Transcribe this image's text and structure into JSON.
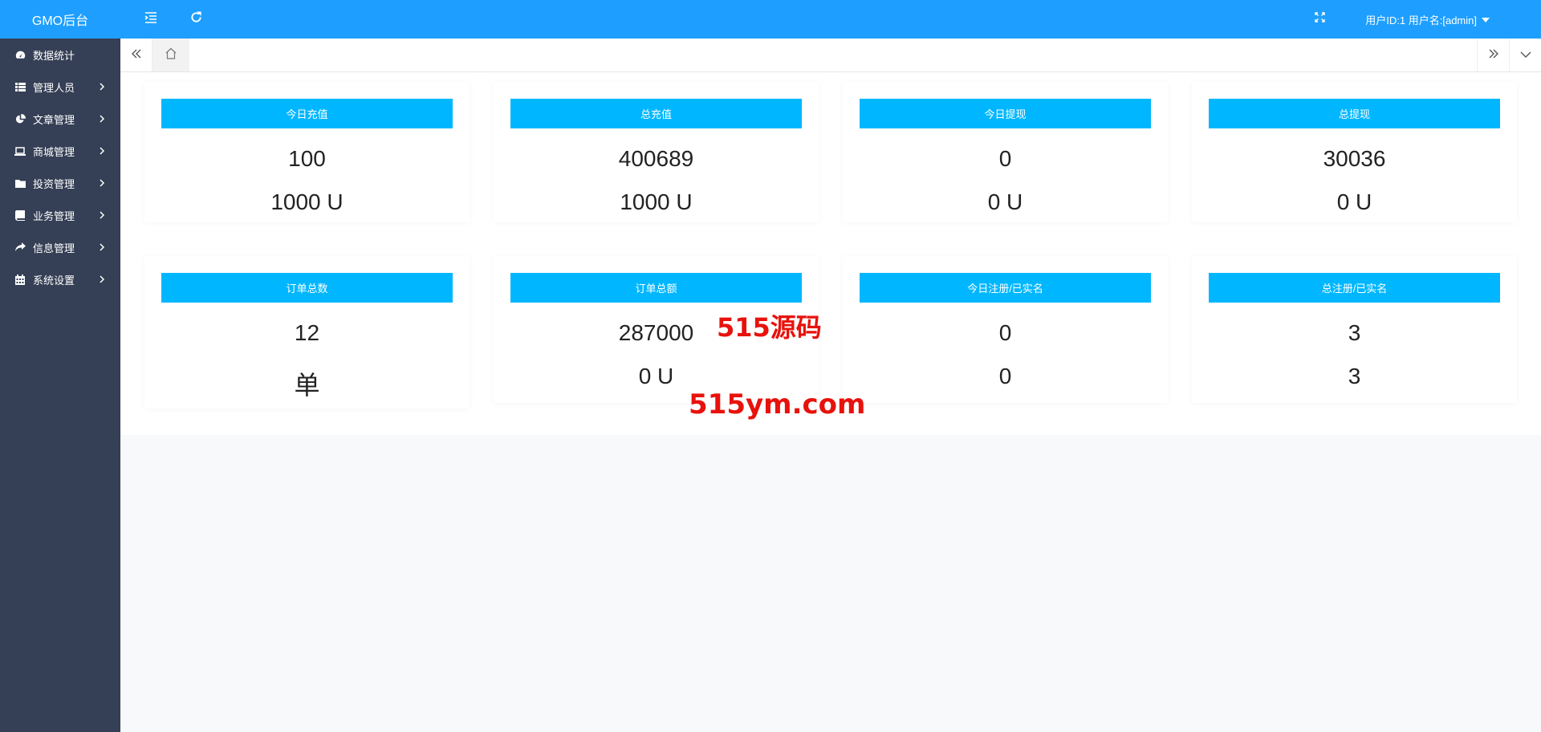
{
  "app": {
    "title": "GMO后台"
  },
  "sidebar": {
    "items": [
      {
        "label": "数据统计",
        "icon": "dashboard-icon",
        "has_children": false
      },
      {
        "label": "管理人员",
        "icon": "grid-icon",
        "has_children": true
      },
      {
        "label": "文章管理",
        "icon": "pie-chart-icon",
        "has_children": true
      },
      {
        "label": "商城管理",
        "icon": "laptop-icon",
        "has_children": true
      },
      {
        "label": "投资管理",
        "icon": "folder-icon",
        "has_children": true
      },
      {
        "label": "业务管理",
        "icon": "book-icon",
        "has_children": true
      },
      {
        "label": "信息管理",
        "icon": "share-icon",
        "has_children": true
      },
      {
        "label": "系统设置",
        "icon": "calendar-icon",
        "has_children": true
      }
    ]
  },
  "header": {
    "user_text": "用户ID:1 用户名:[admin]"
  },
  "cards": [
    {
      "title": "今日充值",
      "value1": "100",
      "value2": "1000 U"
    },
    {
      "title": "总充值",
      "value1": "400689",
      "value2": "1000 U"
    },
    {
      "title": "今日提现",
      "value1": "0",
      "value2": "0 U"
    },
    {
      "title": "总提现",
      "value1": "30036",
      "value2": "0 U"
    },
    {
      "title": "订单总数",
      "value1": "12",
      "value2": "单"
    },
    {
      "title": "订单总额",
      "value1": "287000",
      "value2": "0 U"
    },
    {
      "title": "今日注册/已实名",
      "value1": "0",
      "value2": "0"
    },
    {
      "title": "总注册/已实名",
      "value1": "3",
      "value2": "3"
    }
  ],
  "watermark": {
    "line1": "515源码",
    "line2": "515ym.com"
  },
  "colors": {
    "primary": "#1e9fff",
    "sidebar": "#353f55",
    "card_title": "#00b7ff",
    "watermark": "#e8120c"
  }
}
